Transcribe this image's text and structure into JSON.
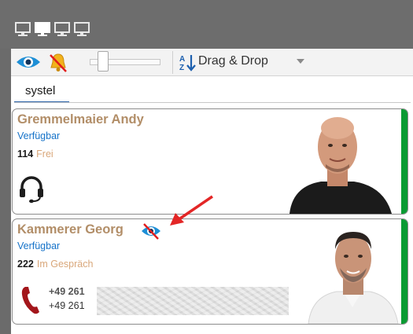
{
  "toolbar": {
    "sort_label": "Drag & Drop",
    "visibility_icon": "eye-icon",
    "bell_icon": "bell-muted-icon",
    "sort_icon": "sort-az-icon"
  },
  "monitors": [
    "monitor-icon",
    "monitor-icon",
    "monitor-icon",
    "monitor-icon"
  ],
  "tabs": [
    {
      "label": "systel"
    }
  ],
  "contacts": [
    {
      "name": "Gremmelmaier Andy",
      "availability": "Verfügbar",
      "extension": "114",
      "state": "Frei",
      "device_icon": "headset-icon"
    },
    {
      "name": "Kammerer Georg",
      "availability": "Verfügbar",
      "extension": "222",
      "state": "Im Gespräch",
      "phone_primary": "+49 261",
      "phone_secondary": "+49 261",
      "device_icon": "phone-handset-icon",
      "visibility_icon": "eye-hidden-icon"
    }
  ],
  "colors": {
    "name": "#b28e68",
    "availability": "#1673c9",
    "status_green": "#0a9a32",
    "call_red": "#a3161b",
    "annotation_arrow": "#e32626"
  }
}
